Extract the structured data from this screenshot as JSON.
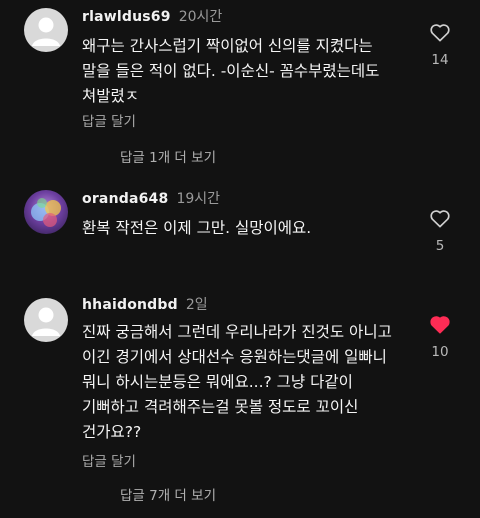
{
  "comments": [
    {
      "username": "rlawldus69",
      "time": "20시간",
      "text": "왜구는 간사스럽기 짝이없어 신의를 지켰다는\n말을 들은 적이 없다. -이순신- 꼼수부렸는데도\n쳐발렸ㅈ",
      "reply_label": "답글 달기",
      "likes": "14",
      "liked": false,
      "view_replies": "답글 1개 더 보기"
    },
    {
      "username": "oranda648",
      "time": "19시간",
      "text": "환복 작전은 이제 그만. 실망이에요.",
      "likes": "5",
      "liked": false
    },
    {
      "username": "hhaidondbd",
      "time": "2일",
      "text": "진짜 궁금해서 그런데 우리나라가 진것도 아니고\n이긴 경기에서 상대선수 응원하는댓글에 일빠니\n뭐니 하시는분등은 뭐에요...? 그냥 다같이\n기뻐하고 격려해주는걸 못볼 정도로 꼬이신\n건가요??",
      "reply_label": "답글 달기",
      "likes": "10",
      "liked": true,
      "view_replies": "답글 7개 더 보기"
    }
  ],
  "colors": {
    "background": "#121212",
    "heart_outline": "#d0d0d0",
    "heart_liked": "#fe2c55",
    "avatar_default": "#d9d9d9"
  },
  "icons": [
    "default-avatar-icon",
    "heart-outline-icon",
    "heart-filled-icon"
  ]
}
